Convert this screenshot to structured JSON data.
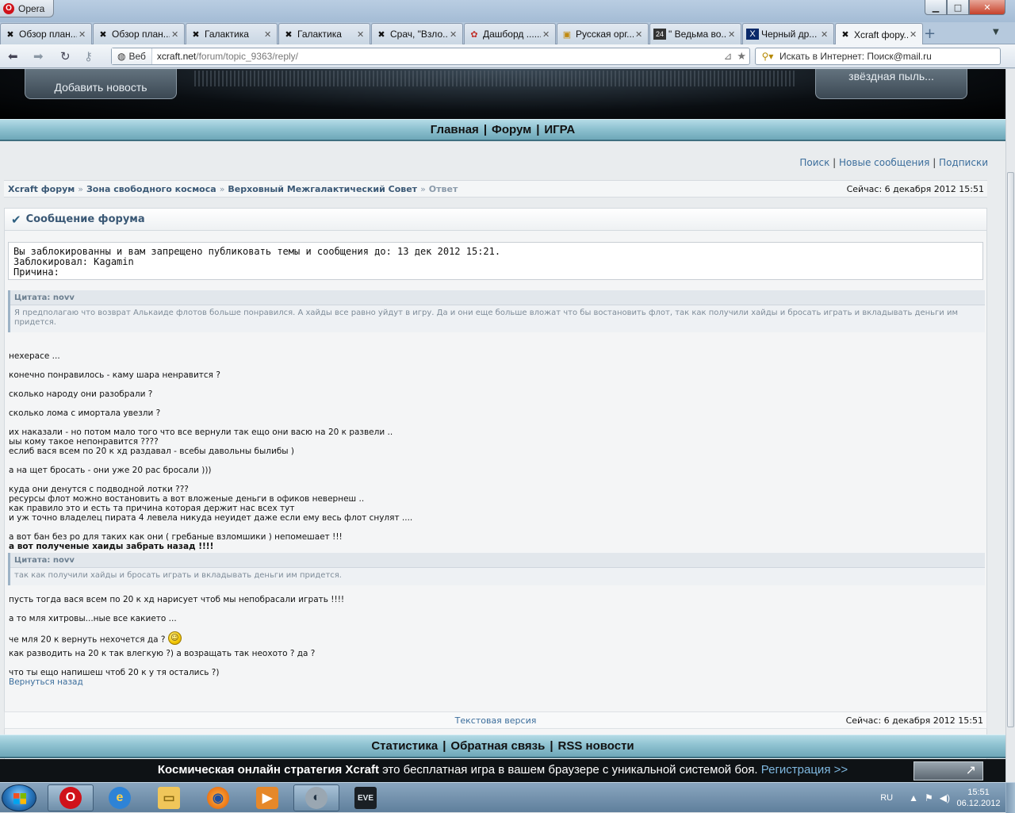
{
  "browser": {
    "app_label": "Opera",
    "tabs": [
      {
        "label": "Обзор план...",
        "icon": "xcraft-icon"
      },
      {
        "label": "Обзор план...",
        "icon": "xcraft-icon"
      },
      {
        "label": "Галактика",
        "icon": "xcraft-icon"
      },
      {
        "label": "Галактика",
        "icon": "xcraft-icon"
      },
      {
        "label": "Срач, \"Взло...",
        "icon": "xcraft-icon"
      },
      {
        "label": "Дашборд ......",
        "icon": "dashboard-icon"
      },
      {
        "label": "Русская орг...",
        "icon": "page-icon"
      },
      {
        "label": "\" Ведьма во...",
        "icon": "24-icon"
      },
      {
        "label": "Черный др...",
        "icon": "x-icon"
      },
      {
        "label": "Xcraft фору...",
        "icon": "xcraft-icon"
      }
    ],
    "address": {
      "badge": "Веб",
      "host": "xcraft.net",
      "path": "/forum/topic_9363/reply/"
    },
    "search_placeholder": "Искать в Интернет: Поиск@mail.ru"
  },
  "site": {
    "header_left_btn": "Добавить новость",
    "header_right_btn": "звёздная пыль...",
    "nav": [
      "Главная",
      "Форум",
      "ИГРА"
    ],
    "toplinks": [
      "Поиск",
      "Новые сообщения",
      "Подписки"
    ]
  },
  "breadcrumb": {
    "items": [
      "Xcraft форум",
      "Зона свободного космоса",
      "Верховный Межгалактический Совет"
    ],
    "current": "Ответ",
    "now": "Сейчас: 6 декабря 2012 15:51"
  },
  "post": {
    "title": "Сообщение форума",
    "ban_text": "Вы заблокированны и вам запрещено публиковать темы и сообщения до: 13 дек 2012 15:21.\nЗаблокировал: Kagamin\nПричина:",
    "quote1": {
      "header": "Цитата: novv",
      "body": "Я предполагаю что возврат Алькаиде флотов больше понравился. А хайды все равно уйдут в игру. Да и они еще больше вложат что бы востановить флот, так как получили хайды и бросать играть и вкладывать деньги им придется."
    },
    "block1": "нехерасе ...\n\nконечно понравилось - каму шара ненравится ?\n\nсколько народу они разобрали ?\n\nсколько лома с имортала увезли ?\n\nих наказали - но потом мало того что все вернули так ещо они васю на 20 к развели ..\nыы кому такое непонравится ????\nеслиб вася всем по 20 к хд раздавал - всебы давольны былибы )\n\nа на щет бросать - они уже 20 рас бросали )))\n\nкуда они денутся с подводной лотки ???\nресурсы флот можно востановить а вот вложеные деньги в офиков невернеш ..\nкак правило это и есть та причина которая держит нас всех тут\nи уж точно владелец пирата 4 левела никуда неуидет даже если ему весь флот снулят ....\n\nа вот бан без ро для таких как они ( гребаные взломшики ) непомешает !!!",
    "block1_bold": "а вот полученые хаиды забрать назад !!!!",
    "quote2": {
      "header": "Цитата: novv",
      "body": "так как получили хайды и бросать играть и вкладывать деньги им придется."
    },
    "block2": "пусть тогда вася всем по 20 к хд нарисует чтоб мы непобрасали играть !!!!\n\nа то мля хитровы...ные все какието ...",
    "block3_line1": "че мля 20 к вернуть нехочется да ? ",
    "block3_rest": "как разводить на 20 к так влегкую ?) а возращать так неохото ? да ?\n\nчто ты ещо напишеш чтоб 20 к у тя остались ?)",
    "back_link": "Вернуться назад"
  },
  "footer": {
    "text_version": "Текстовая версия",
    "now": "Сейчас: 6 декабря 2012 15:51",
    "nav": [
      "Статистика",
      "Обратная связь",
      "RSS новости"
    ],
    "promo_bold": "Космическая онлайн стратегия Xcraft",
    "promo_text": " это бесплатная игра в вашем браузере с уникальной системой боя. ",
    "promo_link": "Регистрация >>"
  },
  "taskbar": {
    "lang": "RU",
    "time": "15:51",
    "date": "06.12.2012",
    "apps": [
      "opera",
      "internet-explorer",
      "explorer",
      "firefox",
      "media-player",
      "skype-like",
      "eve"
    ]
  }
}
